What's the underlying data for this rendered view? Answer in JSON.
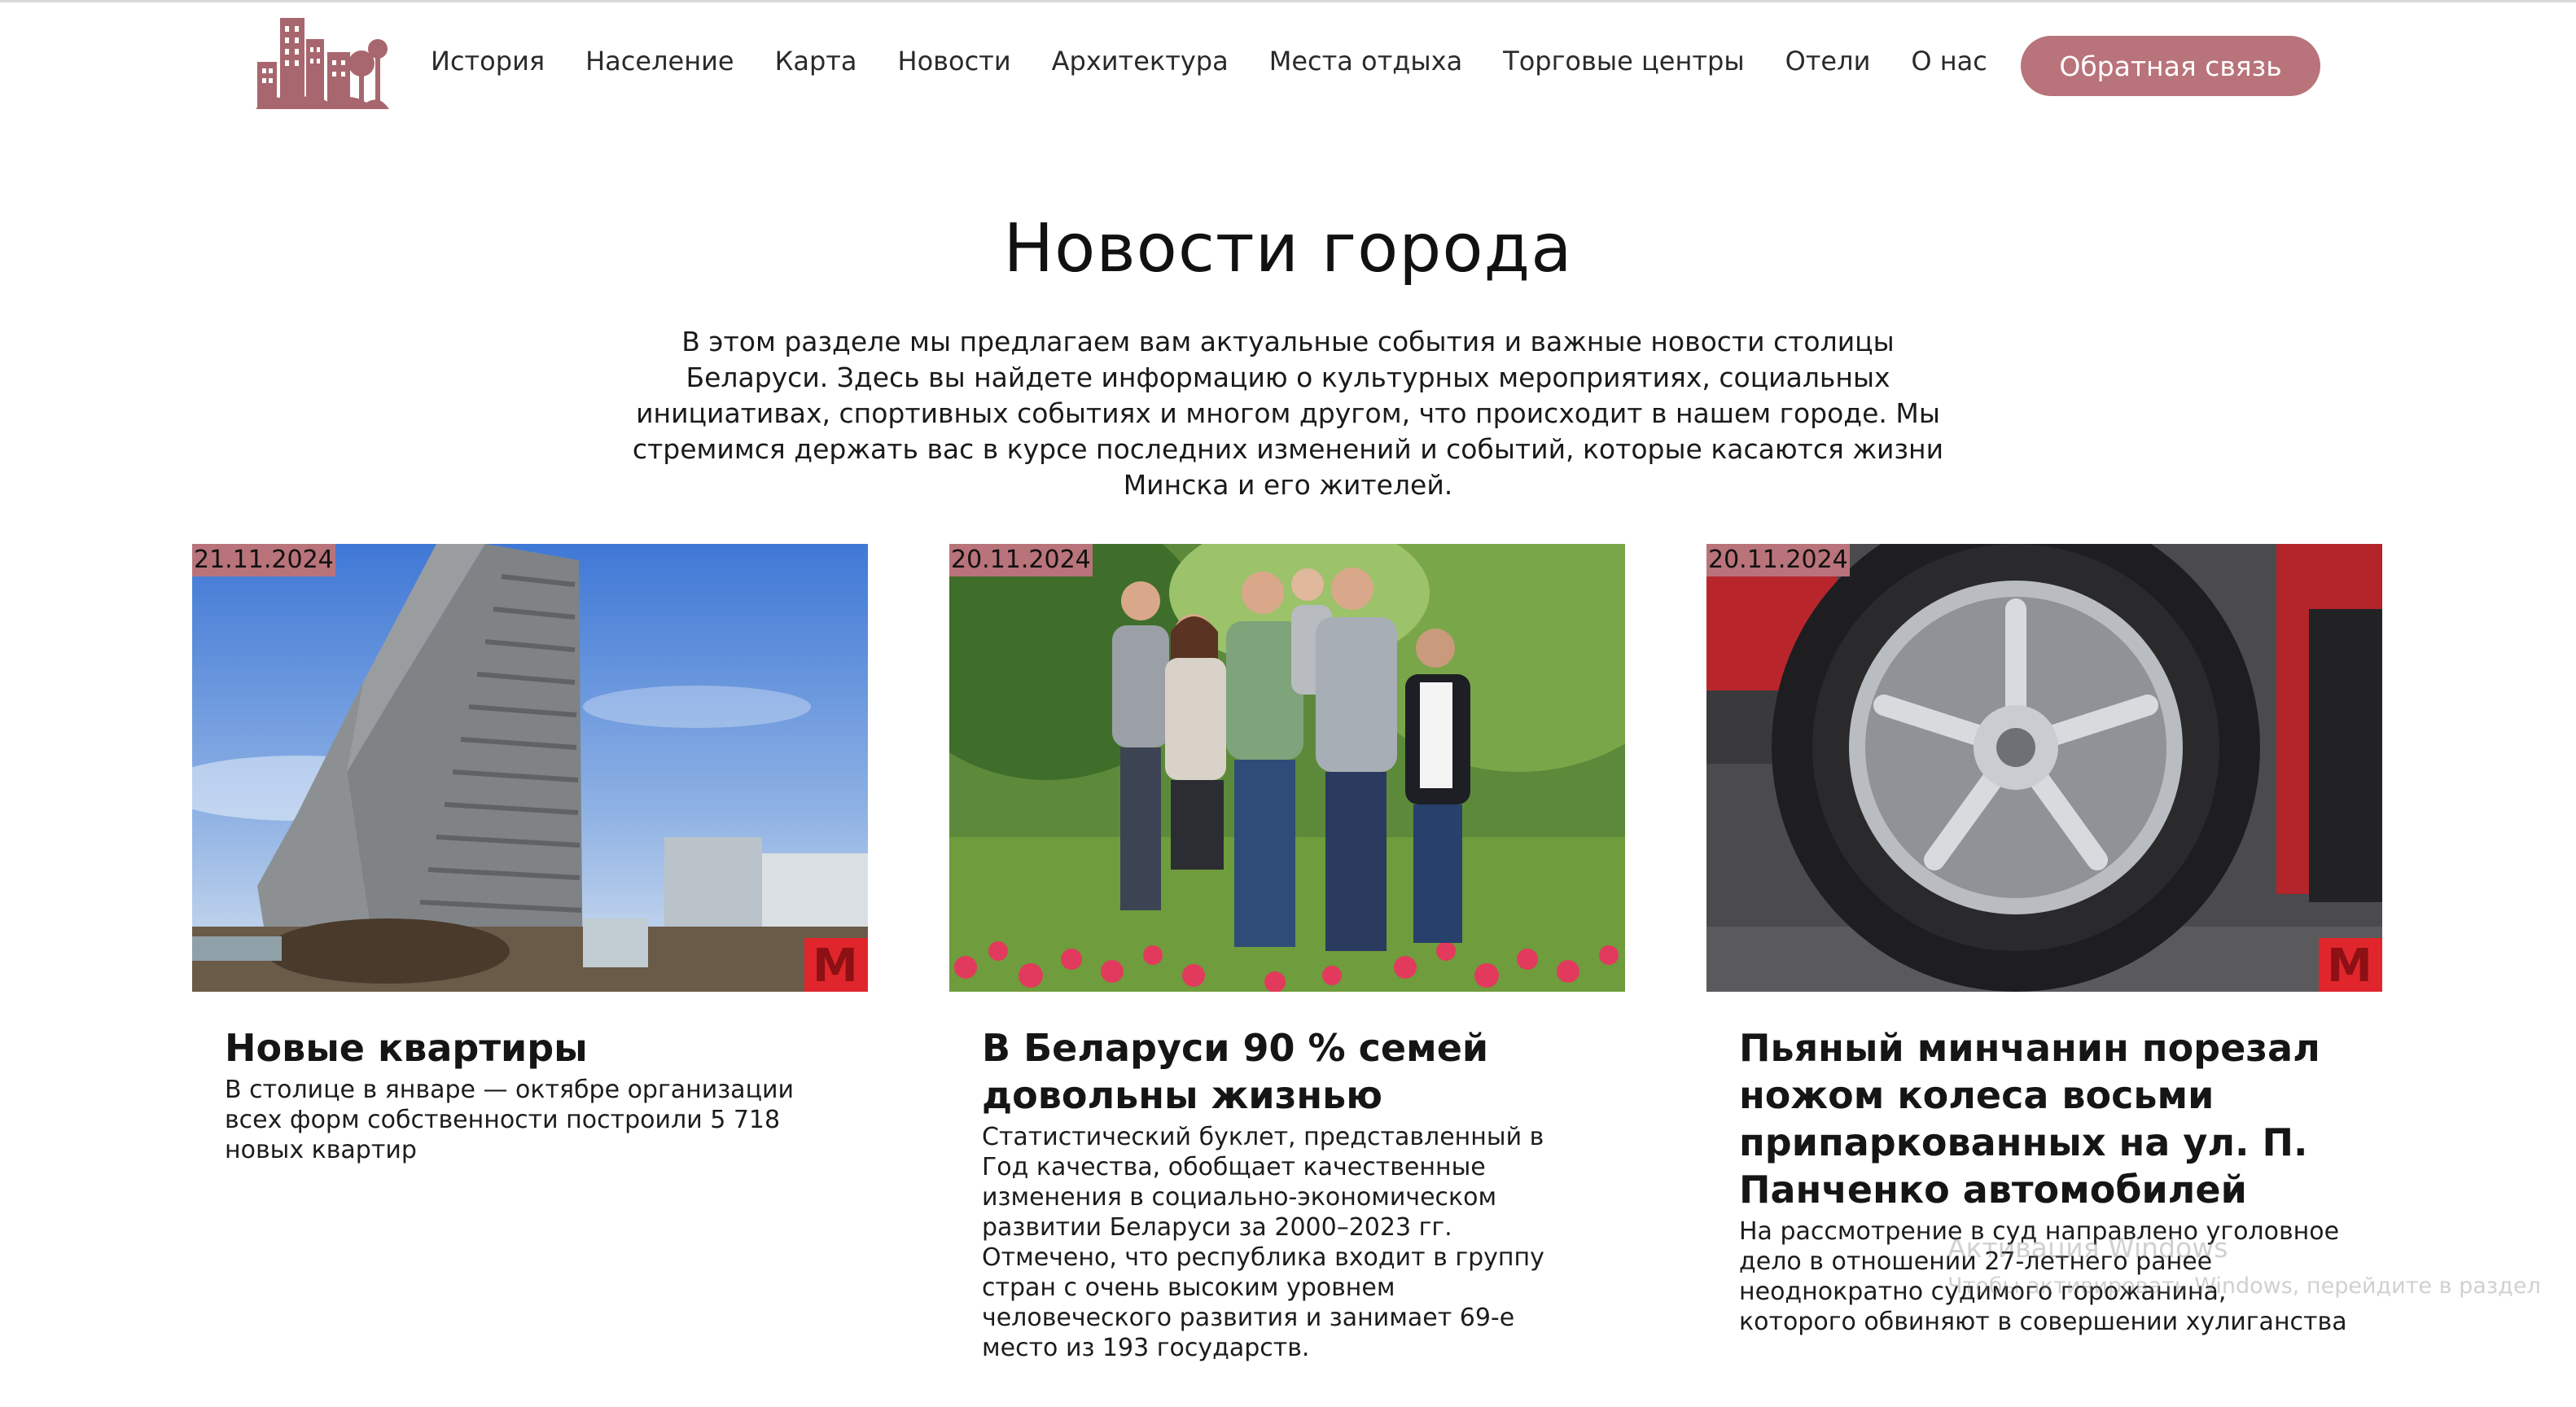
{
  "header": {
    "logo": "city-skyline-logo",
    "nav": [
      "История",
      "Население",
      "Карта",
      "Новости",
      "Архитектура",
      "Места отдыха",
      "Торговые центры",
      "Отели",
      "О нас"
    ],
    "cta_label": "Обратная связь"
  },
  "main": {
    "title": "Новости города",
    "intro": "В этом разделе мы предлагаем вам актуальные события и важные новости столицы Беларуси. Здесь вы найдете информацию о культурных мероприятиях, социальных инициативах, спортивных событиях и многом другом, что происходит в нашем городе. Мы стремимся держать вас в курсе последних изменений и событий, которые касаются жизни Минска и его жителей."
  },
  "news": [
    {
      "date": "21.11.2024",
      "title": "Новые квартиры",
      "text": "В столице в январе — октябре организации всех форм собственности построили 5 718 новых квартир",
      "image": "apartment-building-photo"
    },
    {
      "date": "20.11.2024",
      "title": "В Беларуси 90 % семей довольны жизнью",
      "text": "Статистический буклет, представленный в Год качества, обобщает качественные изменения в социально-экономическом развитии Беларуси за 2000–2023 гг. Отмечено, что республика входит в группу стран с очень высоким уровнем человеческого развития и занимает 69-е место из 193 государств.",
      "image": "family-photo"
    },
    {
      "date": "20.11.2024",
      "title": "Пьяный минчанин порезал ножом колеса восьми припаркованных на ул. П. Панченко автомобилей",
      "text": "На рассмотрение в суд направлено уголовное дело в отношении 27-летнего ранее неоднократно судимого горожанина, которого обвиняют в совершении хулиганства",
      "image": "car-wheel-photo"
    }
  ],
  "watermark": {
    "line1": "Активация Windows",
    "line2": "Чтобы активировать Windows, перейдите в раздел"
  },
  "colors": {
    "accent": "#b9737a",
    "text": "#141414",
    "brand_mark": "#e0262c"
  }
}
